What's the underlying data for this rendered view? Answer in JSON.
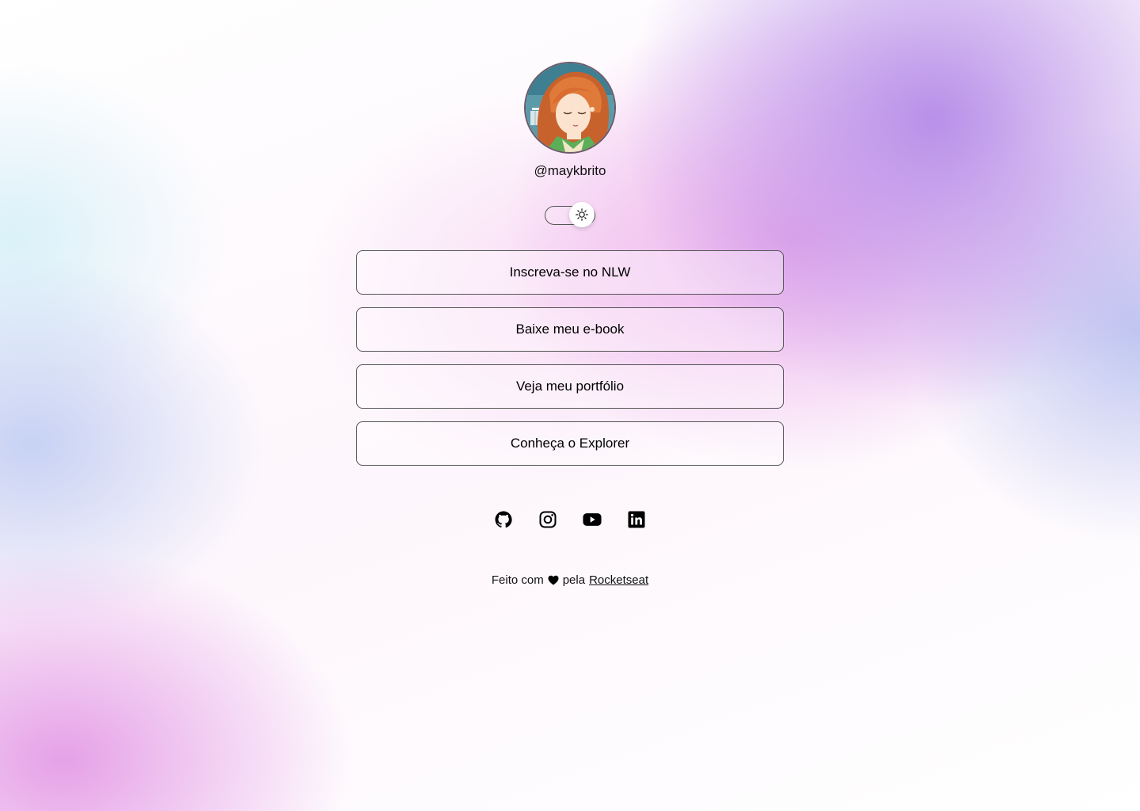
{
  "profile": {
    "username": "@maykbrito",
    "avatar_alt": "Avatar"
  },
  "theme_switch": {
    "icon": "sun-icon",
    "mode": "light"
  },
  "links": [
    {
      "label": "Inscreva-se no NLW"
    },
    {
      "label": "Baixe meu e-book"
    },
    {
      "label": "Veja meu portfólio"
    },
    {
      "label": "Conheça o Explorer"
    }
  ],
  "social": [
    {
      "icon": "github-icon"
    },
    {
      "icon": "instagram-icon"
    },
    {
      "icon": "youtube-icon"
    },
    {
      "icon": "linkedin-icon"
    }
  ],
  "footer": {
    "prefix": "Feito com",
    "middle": "pela",
    "link_label": "Rocketseat"
  },
  "colors": {
    "text": "#000000",
    "border": "#555555",
    "accent_purple": "#b58ce8",
    "accent_pink": "#e8a0e8"
  }
}
